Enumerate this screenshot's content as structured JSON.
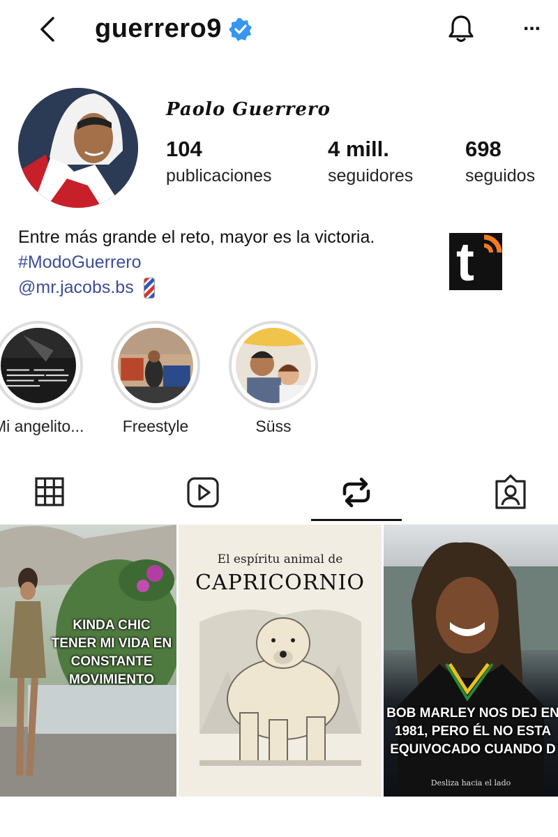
{
  "header": {
    "username": "guerrero9",
    "more_label": "..."
  },
  "profile": {
    "display_name": "Paolo Guerrero",
    "stats": [
      {
        "value": "104",
        "label": "publicaciones"
      },
      {
        "value": "4 mill.",
        "label": "seguidores"
      },
      {
        "value": "698",
        "label": "seguidos"
      }
    ],
    "bio": {
      "text": "Entre más grande el reto, mayor es la victoria.",
      "hashtag": "#ModoGuerrero",
      "mention": "@mr.jacobs.bs"
    }
  },
  "watermark": {
    "letter": "t"
  },
  "highlights": [
    {
      "label": "Mi angelito..."
    },
    {
      "label": "Freestyle"
    },
    {
      "label": "Süss"
    }
  ],
  "tabs": {
    "active": "reposts"
  },
  "posts": [
    {
      "overlay": "KINDA CHIC TENER MI VIDA EN CONSTANTE MOVIMIENTO"
    },
    {
      "subtitle": "El espíritu animal de",
      "title": "CAPRICORNIO"
    },
    {
      "overlay": "BOB MARLEY NOS DEJ EN 1981, PERO ÉL NO ESTA EQUIVOCADO CUANDO D",
      "footer": "Desliza hacia el lado"
    }
  ],
  "colors": {
    "link": "#3c4d9c",
    "verified": "#3797f0",
    "accent": "#111111"
  }
}
